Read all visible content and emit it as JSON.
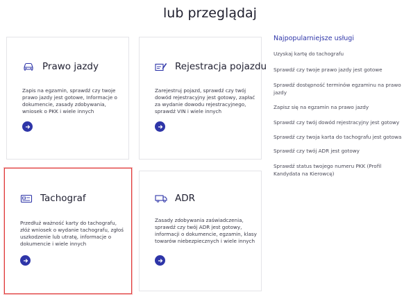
{
  "heading": "lub przeglądaj",
  "cards": [
    {
      "title": "Prawo jazdy",
      "icon": "car-icon",
      "description": "Zapis na egzamin, sprawdź czy twoje\nprawo jazdy jest gotowe, Informacje o\ndokumencie, zasady zdobywania,\nwniosek o PKK i wiele innych"
    },
    {
      "title": "Rejestracja pojazdu",
      "icon": "registration-icon",
      "description": "Zarejestruj pojazd, sprawdź czy twój\ndowód rejestracyjny jest gotowy, zapłać\nza wydanie dowodu rejestracyjnego,\nsprawdź VIN i wiele innych"
    },
    {
      "title": "Tachograf",
      "icon": "tachograph-card-icon",
      "description": "Przedłuż ważność karty do tachografu,\nzłóż wniosek o wydanie tachografu, zgłoś\nuszkodzenie lub utratę, informacje o\ndokumencie i wiele innych"
    },
    {
      "title": "ADR",
      "icon": "truck-icon",
      "description": "Zasady zdobywania zaświadczenia,\nsprawdź czy twój ADR jest gotowy,\ninformacji o dokumencie, egzamin, klasy\ntowarów niebezpiecznych i wiele innych"
    }
  ],
  "sidebar": {
    "title": "Najpopularniejsze usługi",
    "links": [
      "Uzyskaj kartę do tachografu",
      "Sprawdź czy twoje prawo jazdy jest gotowe",
      "Sprawdź dostępność terminów egzaminu na prawo jazdy",
      "Zapisz się na egzamin na prawo jazdy",
      "Sprawdź czy twój dowód rejestracyjny jest gotowy",
      "Sprawdź czy twoja karta do tachografu jest gotowa",
      "Sprawdź czy twój ADR jest gotowy",
      "Sprawdź status twojego numeru PKK (Profil Kandydata na Kierowcę)"
    ]
  },
  "colors": {
    "accent": "#2e35a8",
    "selection": "#e03a3a"
  }
}
